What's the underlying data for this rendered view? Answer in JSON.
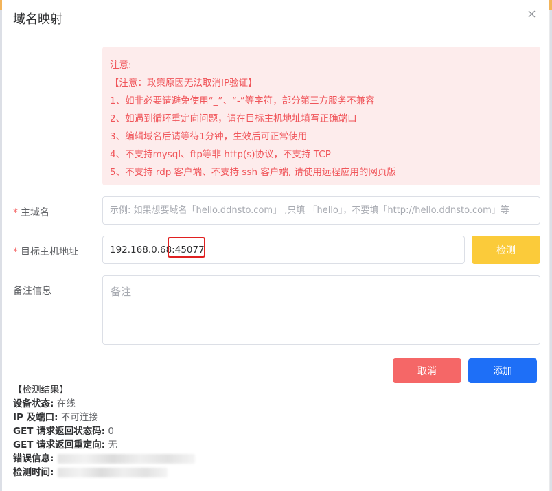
{
  "dialog": {
    "title": "域名映射"
  },
  "notice": {
    "lines": [
      "注意:",
      "【注意：政策原因无法取消IP验证】",
      "1、如非必要请避免使用“_”、“-”等字符，部分第三方服务不兼容",
      "2、如遇到循环重定向问题，请在目标主机地址填写正确端口",
      "3、编辑域名后请等待1分钟，生效后可正常使用",
      "4、不支持mysql、ftp等非 http(s)协议，不支持 TCP",
      "5、不支持 rdp 客户端、不支持 ssh 客户端, 请使用远程应用的网页版"
    ]
  },
  "form": {
    "required_mark": "*",
    "domain": {
      "label": "主域名",
      "value": "",
      "placeholder": "示例: 如果想要域名「hello.ddnsto.com」 ,只填 「hello」，不要填「http://hello.ddnsto.com」等"
    },
    "host": {
      "label": "目标主机地址",
      "value": "192.168.0.68:45077",
      "placeholder": ""
    },
    "remark": {
      "label": "备注信息",
      "value": "",
      "placeholder": "备注"
    }
  },
  "buttons": {
    "check": "检测",
    "cancel": "取消",
    "add": "添加"
  },
  "result": {
    "title": "【检测结果】",
    "items": [
      {
        "key": "设备状态:",
        "value": "在线"
      },
      {
        "key": "IP 及端口:",
        "value": "不可连接"
      },
      {
        "key": "GET 请求返回状态码:",
        "value": "0"
      },
      {
        "key": "GET 请求返回重定向:",
        "value": "无"
      },
      {
        "key": "错误信息:",
        "value": ""
      },
      {
        "key": "检测时间:",
        "value": ""
      }
    ]
  },
  "colors": {
    "notice_bg": "#fdecec",
    "notice_text": "#f0555a",
    "check_button": "#fbcb3a",
    "cancel_button": "#f56767",
    "add_button": "#1e6ff7",
    "annotation": "#e02020"
  }
}
